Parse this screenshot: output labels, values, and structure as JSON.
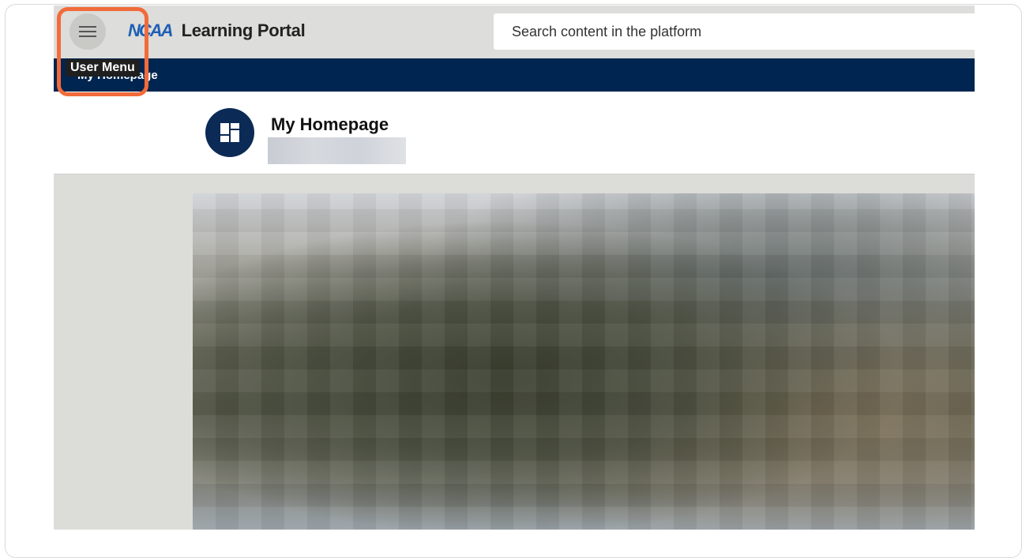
{
  "header": {
    "logo_mark": "NCAA",
    "app_title": "Learning Portal",
    "search_placeholder": "Search content in the platform"
  },
  "menu": {
    "icon": "hamburger-menu-icon",
    "tooltip": "User Menu"
  },
  "breadcrumb": {
    "current": "My Homepage"
  },
  "page": {
    "title": "My Homepage",
    "icon": "dashboard-layout-icon"
  },
  "colors": {
    "navbar": "#002550",
    "highlight": "#f26b3a",
    "logo": "#1e5fb4",
    "home_icon_bg": "#0b2a55"
  }
}
